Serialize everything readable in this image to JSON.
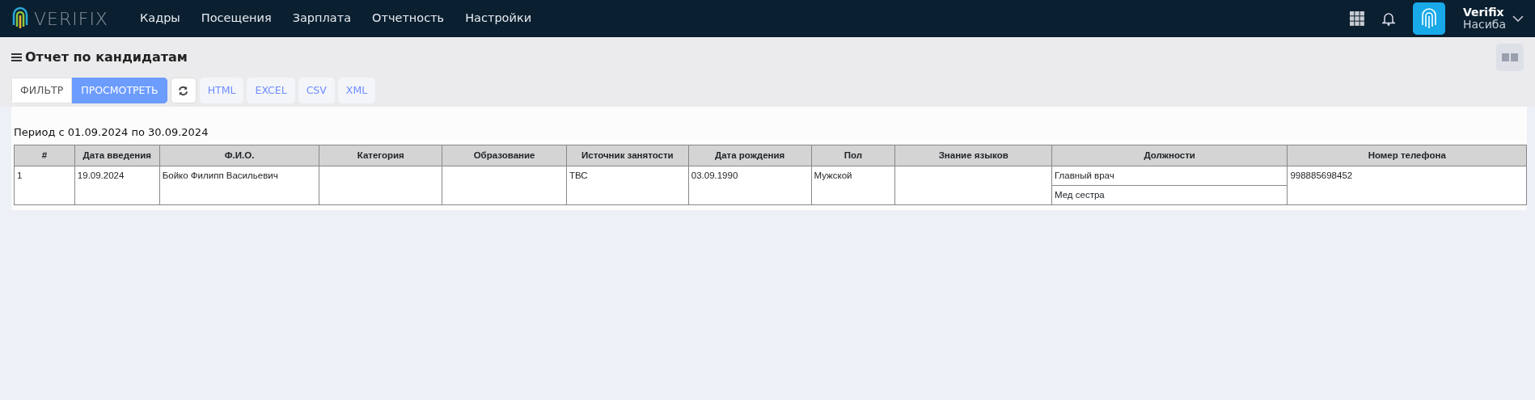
{
  "navbar": {
    "logo": "VERIFIX",
    "menu": [
      "Кадры",
      "Посещения",
      "Зарплата",
      "Отчетность",
      "Настройки"
    ],
    "user": {
      "company": "Verifix",
      "name": "Насиба"
    }
  },
  "page": {
    "title": "Отчет по кандидатам"
  },
  "toolbar": {
    "modes": [
      {
        "label": "ФИЛЬТР",
        "selected": false
      },
      {
        "label": "ПРОСМОТРЕТЬ",
        "selected": true
      }
    ],
    "exports": [
      "HTML",
      "EXCEL",
      "CSV",
      "XML"
    ]
  },
  "report": {
    "period": "Период с 01.09.2024 по 30.09.2024",
    "table": {
      "columns": [
        "#",
        "Дата введения",
        "Ф.И.О.",
        "Категория",
        "Образование",
        "Источник занятости",
        "Дата рождения",
        "Пол",
        "Знание языков",
        "Должности",
        "Номер телефона"
      ],
      "rows": [
        {
          "number": "1",
          "date": "19.09.2024",
          "name": "Бойко Филипп Васильевич",
          "category": "",
          "education": "",
          "source": "ТВС",
          "birth_date": "03.09.1990",
          "gender": "Мужской",
          "languages": "",
          "positions": [
            "Главный врач",
            "Мед сестра"
          ],
          "phone": "998885698452"
        }
      ]
    }
  }
}
